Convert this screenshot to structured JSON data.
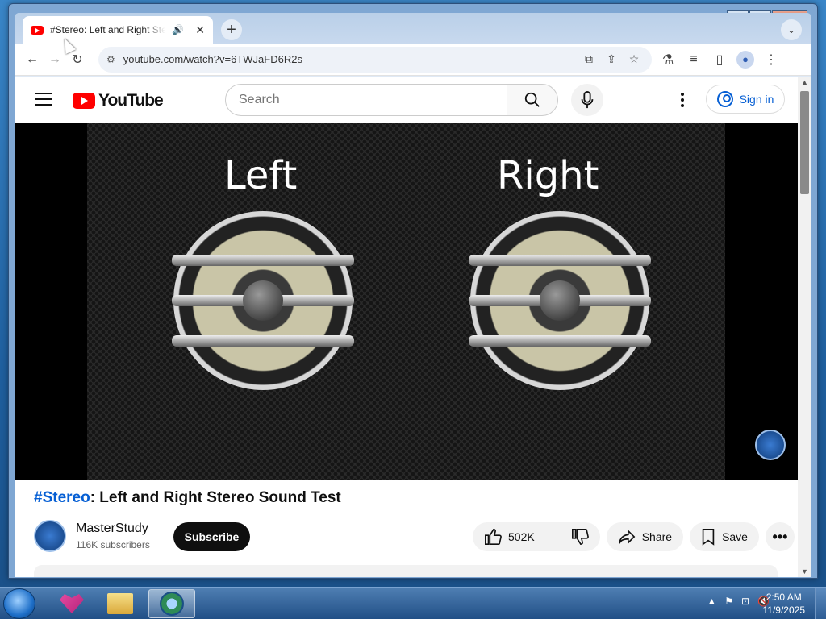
{
  "tab": {
    "title": "#Stereo: Left and Right Stereo Sound Test",
    "audio_icon": "speaker-icon",
    "close": "✕"
  },
  "toolbar": {
    "url": "youtube.com/watch?v=6TWJaFD6R2s"
  },
  "youtube": {
    "logo_text": "YouTube",
    "search_placeholder": "Search",
    "signin_label": "Sign in"
  },
  "video": {
    "left_label": "Left",
    "right_label": "Right",
    "title_hashtag": "#Stereo",
    "title_rest": ": Left and Right Stereo Sound Test",
    "channel_name": "MasterStudy",
    "subscribers": "116K subscribers",
    "subscribe_label": "Subscribe",
    "likes": "502K",
    "share_label": "Share",
    "save_label": "Save"
  },
  "taskbar": {
    "time": "2:50 AM",
    "date": "11/9/2025"
  },
  "colors": {
    "yt_red": "#ff0000",
    "link_blue": "#065fd4",
    "subscribe_bg": "#0f0f0f"
  }
}
